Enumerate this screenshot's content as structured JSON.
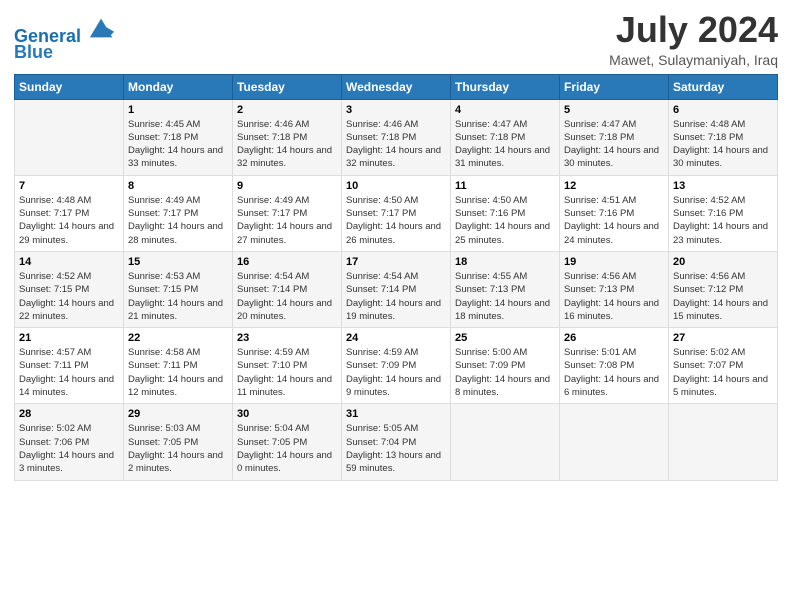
{
  "header": {
    "logo_line1": "General",
    "logo_line2": "Blue",
    "month_year": "July 2024",
    "location": "Mawet, Sulaymaniyah, Iraq"
  },
  "columns": [
    "Sunday",
    "Monday",
    "Tuesday",
    "Wednesday",
    "Thursday",
    "Friday",
    "Saturday"
  ],
  "weeks": [
    [
      {
        "day": "",
        "sunrise": "",
        "sunset": "",
        "daylight": ""
      },
      {
        "day": "1",
        "sunrise": "Sunrise: 4:45 AM",
        "sunset": "Sunset: 7:18 PM",
        "daylight": "Daylight: 14 hours and 33 minutes."
      },
      {
        "day": "2",
        "sunrise": "Sunrise: 4:46 AM",
        "sunset": "Sunset: 7:18 PM",
        "daylight": "Daylight: 14 hours and 32 minutes."
      },
      {
        "day": "3",
        "sunrise": "Sunrise: 4:46 AM",
        "sunset": "Sunset: 7:18 PM",
        "daylight": "Daylight: 14 hours and 32 minutes."
      },
      {
        "day": "4",
        "sunrise": "Sunrise: 4:47 AM",
        "sunset": "Sunset: 7:18 PM",
        "daylight": "Daylight: 14 hours and 31 minutes."
      },
      {
        "day": "5",
        "sunrise": "Sunrise: 4:47 AM",
        "sunset": "Sunset: 7:18 PM",
        "daylight": "Daylight: 14 hours and 30 minutes."
      },
      {
        "day": "6",
        "sunrise": "Sunrise: 4:48 AM",
        "sunset": "Sunset: 7:18 PM",
        "daylight": "Daylight: 14 hours and 30 minutes."
      }
    ],
    [
      {
        "day": "7",
        "sunrise": "Sunrise: 4:48 AM",
        "sunset": "Sunset: 7:17 PM",
        "daylight": "Daylight: 14 hours and 29 minutes."
      },
      {
        "day": "8",
        "sunrise": "Sunrise: 4:49 AM",
        "sunset": "Sunset: 7:17 PM",
        "daylight": "Daylight: 14 hours and 28 minutes."
      },
      {
        "day": "9",
        "sunrise": "Sunrise: 4:49 AM",
        "sunset": "Sunset: 7:17 PM",
        "daylight": "Daylight: 14 hours and 27 minutes."
      },
      {
        "day": "10",
        "sunrise": "Sunrise: 4:50 AM",
        "sunset": "Sunset: 7:17 PM",
        "daylight": "Daylight: 14 hours and 26 minutes."
      },
      {
        "day": "11",
        "sunrise": "Sunrise: 4:50 AM",
        "sunset": "Sunset: 7:16 PM",
        "daylight": "Daylight: 14 hours and 25 minutes."
      },
      {
        "day": "12",
        "sunrise": "Sunrise: 4:51 AM",
        "sunset": "Sunset: 7:16 PM",
        "daylight": "Daylight: 14 hours and 24 minutes."
      },
      {
        "day": "13",
        "sunrise": "Sunrise: 4:52 AM",
        "sunset": "Sunset: 7:16 PM",
        "daylight": "Daylight: 14 hours and 23 minutes."
      }
    ],
    [
      {
        "day": "14",
        "sunrise": "Sunrise: 4:52 AM",
        "sunset": "Sunset: 7:15 PM",
        "daylight": "Daylight: 14 hours and 22 minutes."
      },
      {
        "day": "15",
        "sunrise": "Sunrise: 4:53 AM",
        "sunset": "Sunset: 7:15 PM",
        "daylight": "Daylight: 14 hours and 21 minutes."
      },
      {
        "day": "16",
        "sunrise": "Sunrise: 4:54 AM",
        "sunset": "Sunset: 7:14 PM",
        "daylight": "Daylight: 14 hours and 20 minutes."
      },
      {
        "day": "17",
        "sunrise": "Sunrise: 4:54 AM",
        "sunset": "Sunset: 7:14 PM",
        "daylight": "Daylight: 14 hours and 19 minutes."
      },
      {
        "day": "18",
        "sunrise": "Sunrise: 4:55 AM",
        "sunset": "Sunset: 7:13 PM",
        "daylight": "Daylight: 14 hours and 18 minutes."
      },
      {
        "day": "19",
        "sunrise": "Sunrise: 4:56 AM",
        "sunset": "Sunset: 7:13 PM",
        "daylight": "Daylight: 14 hours and 16 minutes."
      },
      {
        "day": "20",
        "sunrise": "Sunrise: 4:56 AM",
        "sunset": "Sunset: 7:12 PM",
        "daylight": "Daylight: 14 hours and 15 minutes."
      }
    ],
    [
      {
        "day": "21",
        "sunrise": "Sunrise: 4:57 AM",
        "sunset": "Sunset: 7:11 PM",
        "daylight": "Daylight: 14 hours and 14 minutes."
      },
      {
        "day": "22",
        "sunrise": "Sunrise: 4:58 AM",
        "sunset": "Sunset: 7:11 PM",
        "daylight": "Daylight: 14 hours and 12 minutes."
      },
      {
        "day": "23",
        "sunrise": "Sunrise: 4:59 AM",
        "sunset": "Sunset: 7:10 PM",
        "daylight": "Daylight: 14 hours and 11 minutes."
      },
      {
        "day": "24",
        "sunrise": "Sunrise: 4:59 AM",
        "sunset": "Sunset: 7:09 PM",
        "daylight": "Daylight: 14 hours and 9 minutes."
      },
      {
        "day": "25",
        "sunrise": "Sunrise: 5:00 AM",
        "sunset": "Sunset: 7:09 PM",
        "daylight": "Daylight: 14 hours and 8 minutes."
      },
      {
        "day": "26",
        "sunrise": "Sunrise: 5:01 AM",
        "sunset": "Sunset: 7:08 PM",
        "daylight": "Daylight: 14 hours and 6 minutes."
      },
      {
        "day": "27",
        "sunrise": "Sunrise: 5:02 AM",
        "sunset": "Sunset: 7:07 PM",
        "daylight": "Daylight: 14 hours and 5 minutes."
      }
    ],
    [
      {
        "day": "28",
        "sunrise": "Sunrise: 5:02 AM",
        "sunset": "Sunset: 7:06 PM",
        "daylight": "Daylight: 14 hours and 3 minutes."
      },
      {
        "day": "29",
        "sunrise": "Sunrise: 5:03 AM",
        "sunset": "Sunset: 7:05 PM",
        "daylight": "Daylight: 14 hours and 2 minutes."
      },
      {
        "day": "30",
        "sunrise": "Sunrise: 5:04 AM",
        "sunset": "Sunset: 7:05 PM",
        "daylight": "Daylight: 14 hours and 0 minutes."
      },
      {
        "day": "31",
        "sunrise": "Sunrise: 5:05 AM",
        "sunset": "Sunset: 7:04 PM",
        "daylight": "Daylight: 13 hours and 59 minutes."
      },
      {
        "day": "",
        "sunrise": "",
        "sunset": "",
        "daylight": ""
      },
      {
        "day": "",
        "sunrise": "",
        "sunset": "",
        "daylight": ""
      },
      {
        "day": "",
        "sunrise": "",
        "sunset": "",
        "daylight": ""
      }
    ]
  ]
}
